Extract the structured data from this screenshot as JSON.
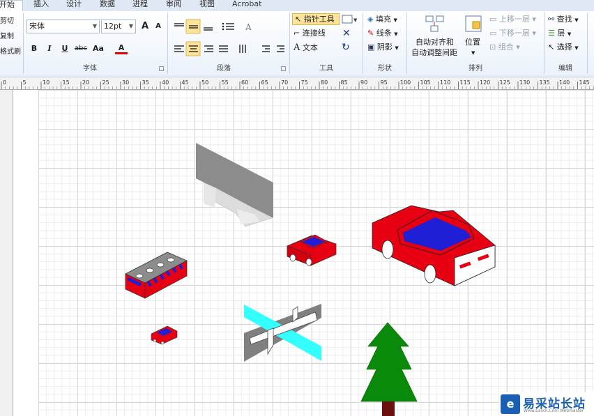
{
  "tabs": [
    {
      "label": "开始",
      "active": true
    },
    {
      "label": "插入"
    },
    {
      "label": "设计"
    },
    {
      "label": "数据"
    },
    {
      "label": "进程"
    },
    {
      "label": "审阅"
    },
    {
      "label": "视图"
    },
    {
      "label": "Acrobat"
    }
  ],
  "clipboard": {
    "cut": "剪切",
    "copy": "复制",
    "format": "格式刷"
  },
  "font": {
    "family": "宋体",
    "size": "12pt",
    "grow": "A",
    "shrink": "A",
    "bold": "B",
    "italic": "I",
    "underline": "U",
    "strike": "abc",
    "case": "Aa",
    "color_btn": "A",
    "group_label": "字体"
  },
  "paragraph": {
    "group_label": "段落"
  },
  "tools": {
    "pointer": "指针工具",
    "connector": "连接线",
    "text": "文本",
    "group_label": "工具"
  },
  "shape": {
    "fill": "填充",
    "line": "线条",
    "shadow": "阴影",
    "group_label": "形状"
  },
  "arrange": {
    "auto_align": "自动对齐和",
    "auto_spacing": "自动调整间距",
    "position": "位置",
    "bring_forward": "上移一层",
    "send_backward": "下移一层",
    "group": "组合",
    "group_label": "排列"
  },
  "editing": {
    "find": "查找",
    "layers": "层",
    "select": "选择",
    "group_label": "编辑"
  },
  "ruler": {
    "labels": [
      "0",
      "5",
      "10",
      "15",
      "20",
      "25",
      "30",
      "35",
      "40",
      "45",
      "50",
      "55",
      "60",
      "65",
      "70",
      "75",
      "80",
      "85",
      "90",
      "95",
      "100",
      "105",
      "110",
      "115",
      "120",
      "125",
      "130",
      "135",
      "140",
      "145"
    ]
  },
  "colors": {
    "accent": "#1a5fb4",
    "car": "#e60012",
    "window": "#1f1fd6",
    "tree": "#0a8a0a",
    "trunk": "#6b0f0f",
    "water": "#33ffff",
    "bridge": "#808080"
  },
  "watermark": {
    "main": "易采站长站",
    "sub": "Www.Easck.Com Webmaster"
  }
}
